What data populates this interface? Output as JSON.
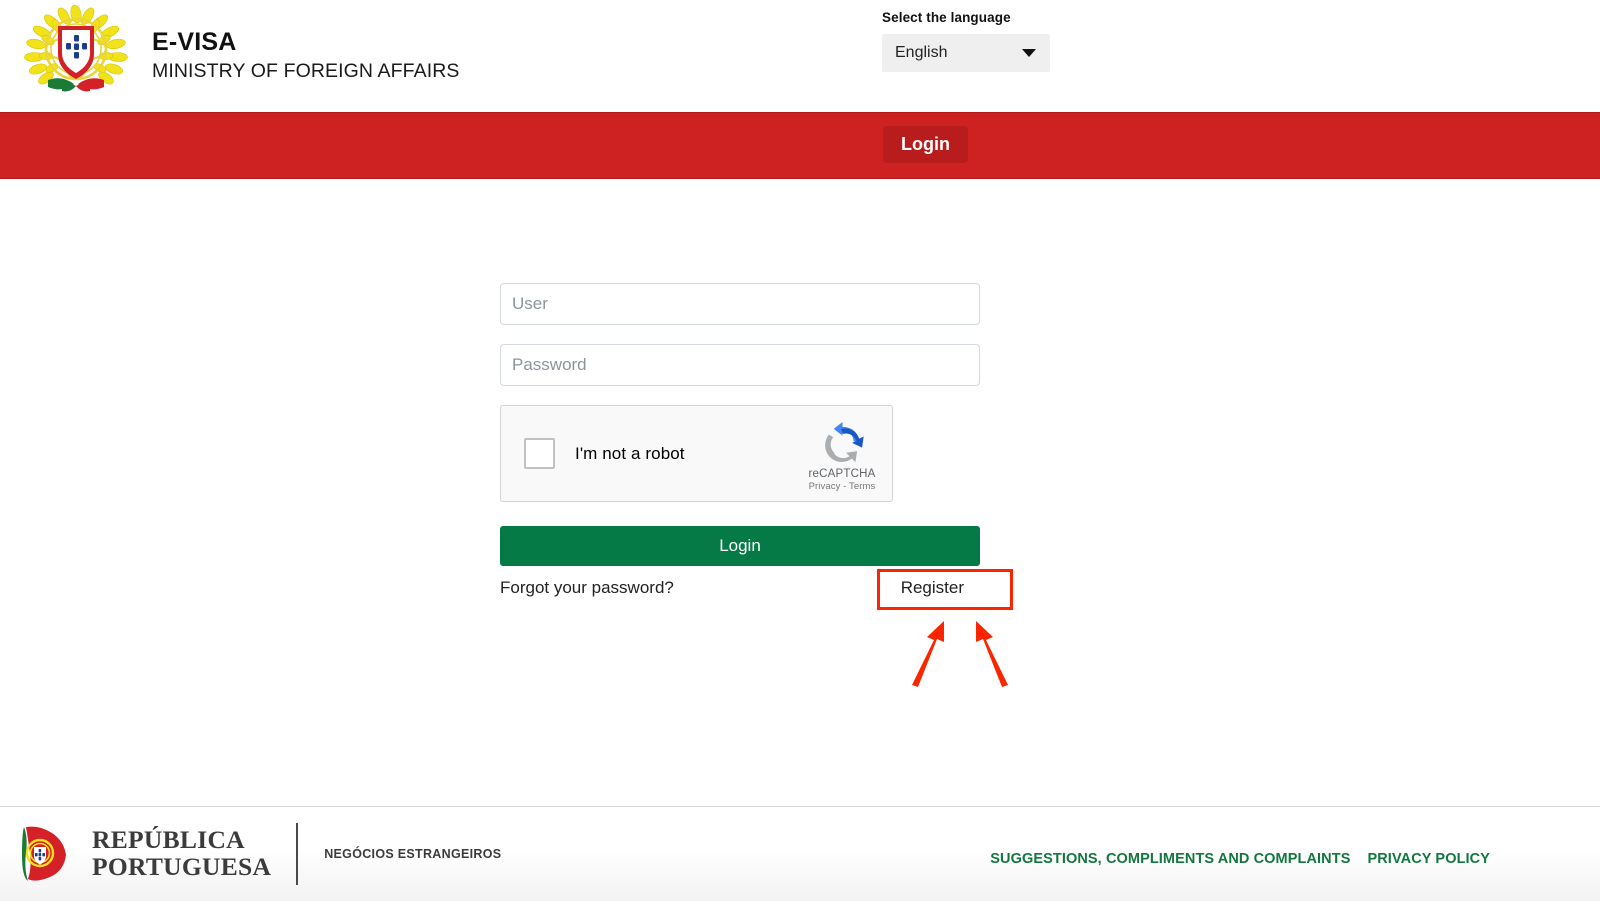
{
  "header": {
    "brand_title": "E-VISA",
    "brand_subtitle": "MINISTRY OF FOREIGN AFFAIRS",
    "logo_name": "portugal-coat-of-arms",
    "language": {
      "label": "Select the language",
      "selected": "English",
      "caret_icon": "chevron-down-icon"
    }
  },
  "nav": {
    "items": [
      {
        "label": "Login",
        "active": true
      }
    ],
    "bar_color": "#ce2121",
    "active_color": "#b81c1c"
  },
  "form": {
    "user_placeholder": "User",
    "password_placeholder": "Password",
    "user_value": "",
    "password_value": "",
    "recaptcha": {
      "checkbox_label": "I'm not a robot",
      "brand": "reCAPTCHA",
      "terms": "Privacy - Terms",
      "logo_name": "recaptcha-logo",
      "checked": false
    },
    "login_label": "Login",
    "login_color": "#057a46",
    "forgot_label": "Forgot your password?",
    "register_label": "Register"
  },
  "annotation": {
    "highlight_target": "Register",
    "color": "#fa2600",
    "arrow_count": 2
  },
  "footer": {
    "logo_name": "republica-portuguesa-logo",
    "logo_line1": "REPÚBLICA",
    "logo_line2": "PORTUGUESA",
    "department": "NEGÓCIOS ESTRANGEIROS",
    "links": [
      "SUGGESTIONS, COMPLIMENTS AND COMPLAINTS",
      "PRIVACY POLICY"
    ],
    "link_color": "#12773f"
  }
}
